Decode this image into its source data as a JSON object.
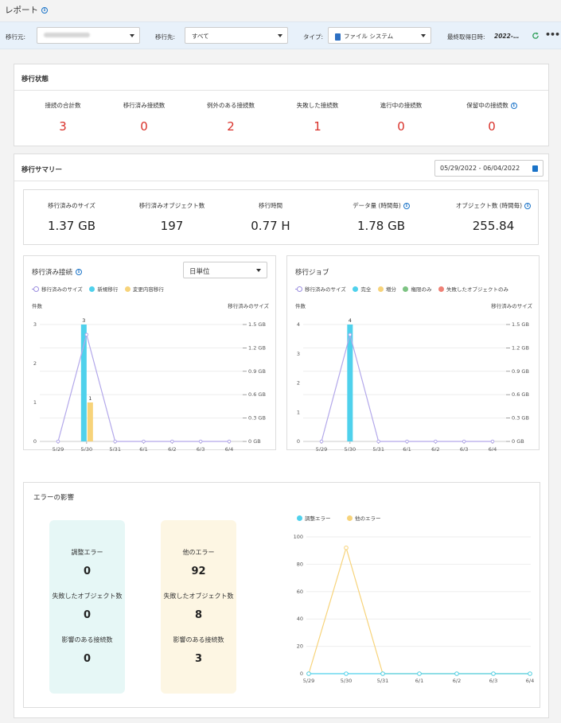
{
  "header": {
    "title": "レポート"
  },
  "filters": {
    "source_label": "移行元:",
    "dest_label": "移行先:",
    "dest_value": "すべて",
    "type_label": "タイプ:",
    "type_value": "ファイル システム",
    "last_fetch_label": "最終取得日時:",
    "last_fetch_value": "2022-…"
  },
  "status": {
    "title": "移行状態",
    "items": [
      {
        "label": "接続の合計数",
        "value": "3"
      },
      {
        "label": "移行済み接続数",
        "value": "0"
      },
      {
        "label": "例外のある接続数",
        "value": "2"
      },
      {
        "label": "失敗した接続数",
        "value": "1"
      },
      {
        "label": "進行中の接続数",
        "value": "0"
      },
      {
        "label": "保留中の接続数",
        "value": "0"
      }
    ]
  },
  "summary": {
    "title": "移行サマリー",
    "date_range": "05/29/2022 - 06/04/2022",
    "items": [
      {
        "label": "移行済みのサイズ",
        "value": "1.37 GB"
      },
      {
        "label": "移行済みオブジェクト数",
        "value": "197"
      },
      {
        "label": "移行時間",
        "value": "0.77 H"
      },
      {
        "label": "データ量 (時間毎)",
        "value": "1.78 GB"
      },
      {
        "label": "オブジェクト数 (時間毎)",
        "value": "255.84"
      }
    ]
  },
  "connections_chart": {
    "title": "移行済み接続",
    "granularity": "日単位",
    "legend": [
      "移行済みのサイズ",
      "新規移行",
      "変更内容移行"
    ],
    "left_axis_label": "件数",
    "right_axis_label": "移行済みのサイズ",
    "left_ticks": [
      "0",
      "1",
      "2",
      "3"
    ],
    "right_ticks": [
      "0 GB",
      "0.3 GB",
      "0.6 GB",
      "0.9 GB",
      "1.2 GB",
      "1.5 GB"
    ],
    "x_labels": [
      "5/29",
      "5/30",
      "5/31",
      "6/1",
      "6/2",
      "6/3",
      "6/4"
    ],
    "bar_labels": [
      "3",
      "1"
    ]
  },
  "jobs_chart": {
    "title": "移行ジョブ",
    "legend": [
      "移行済みのサイズ",
      "完全",
      "増分",
      "権限のみ",
      "失敗したオブジェクトのみ"
    ],
    "left_axis_label": "件数",
    "right_axis_label": "移行済みのサイズ",
    "left_ticks": [
      "0",
      "1",
      "2",
      "3",
      "4"
    ],
    "right_ticks": [
      "0 GB",
      "0.3 GB",
      "0.6 GB",
      "0.9 GB",
      "1.2 GB",
      "1.5 GB"
    ],
    "x_labels": [
      "5/29",
      "5/30",
      "5/31",
      "6/1",
      "6/2",
      "6/3",
      "6/4"
    ],
    "bar_labels": [
      "4"
    ]
  },
  "errors": {
    "title": "エラーの影響",
    "adjust": {
      "title": "調整エラー",
      "value": "0",
      "failed_label": "失敗したオブジェクト数",
      "failed_value": "0",
      "conn_label": "影響のある接続数",
      "conn_value": "0"
    },
    "other": {
      "title": "他のエラー",
      "value": "92",
      "failed_label": "失敗したオブジェクト数",
      "failed_value": "8",
      "conn_label": "影響のある接続数",
      "conn_value": "3"
    },
    "legend": [
      "調整エラー",
      "他のエラー"
    ],
    "y_ticks": [
      "0",
      "20",
      "40",
      "60",
      "80",
      "100"
    ],
    "x_labels": [
      "5/29",
      "5/30",
      "5/31",
      "6/1",
      "6/2",
      "6/3",
      "6/4"
    ]
  },
  "colors": {
    "accent_blue": "#4fd1ec",
    "accent_yellow": "#f7d37a",
    "line_purple": "#b3a8ea",
    "green": "#7dc383",
    "red": "#ef8176",
    "stat_red": "#d9322b"
  },
  "chart_data": [
    {
      "type": "bar",
      "title": "移行済み接続",
      "categories": [
        "5/29",
        "5/30",
        "5/31",
        "6/1",
        "6/2",
        "6/3",
        "6/4"
      ],
      "series": [
        {
          "name": "新規移行",
          "values": [
            0,
            3,
            0,
            0,
            0,
            0,
            0
          ]
        },
        {
          "name": "変更内容移行",
          "values": [
            0,
            1,
            0,
            0,
            0,
            0,
            0
          ]
        }
      ],
      "line_series": {
        "name": "移行済みのサイズ",
        "values": [
          0,
          1.37,
          0,
          0,
          0,
          0,
          0
        ]
      },
      "ylabel": "件数",
      "ylim": [
        0,
        3
      ],
      "y2label": "移行済みのサイズ",
      "y2lim": [
        0,
        1.5
      ]
    },
    {
      "type": "bar",
      "title": "移行ジョブ",
      "categories": [
        "5/29",
        "5/30",
        "5/31",
        "6/1",
        "6/2",
        "6/3",
        "6/4"
      ],
      "series": [
        {
          "name": "完全",
          "values": [
            0,
            4,
            0,
            0,
            0,
            0,
            0
          ]
        },
        {
          "name": "増分",
          "values": [
            0,
            0,
            0,
            0,
            0,
            0,
            0
          ]
        },
        {
          "name": "権限のみ",
          "values": [
            0,
            0,
            0,
            0,
            0,
            0,
            0
          ]
        },
        {
          "name": "失敗したオブジェクトのみ",
          "values": [
            0,
            0,
            0,
            0,
            0,
            0,
            0
          ]
        }
      ],
      "line_series": {
        "name": "移行済みのサイズ",
        "values": [
          0,
          1.37,
          0,
          0,
          0,
          0,
          0
        ]
      },
      "ylabel": "件数",
      "ylim": [
        0,
        4
      ],
      "y2label": "移行済みのサイズ",
      "y2lim": [
        0,
        1.5
      ]
    },
    {
      "type": "line",
      "categories": [
        "5/29",
        "5/30",
        "5/31",
        "6/1",
        "6/2",
        "6/3",
        "6/4"
      ],
      "series": [
        {
          "name": "調整エラー",
          "values": [
            0,
            0,
            0,
            0,
            0,
            0,
            0
          ]
        },
        {
          "name": "他のエラー",
          "values": [
            0,
            92,
            0,
            0,
            0,
            0,
            0
          ]
        }
      ],
      "ylim": [
        0,
        100
      ]
    }
  ]
}
